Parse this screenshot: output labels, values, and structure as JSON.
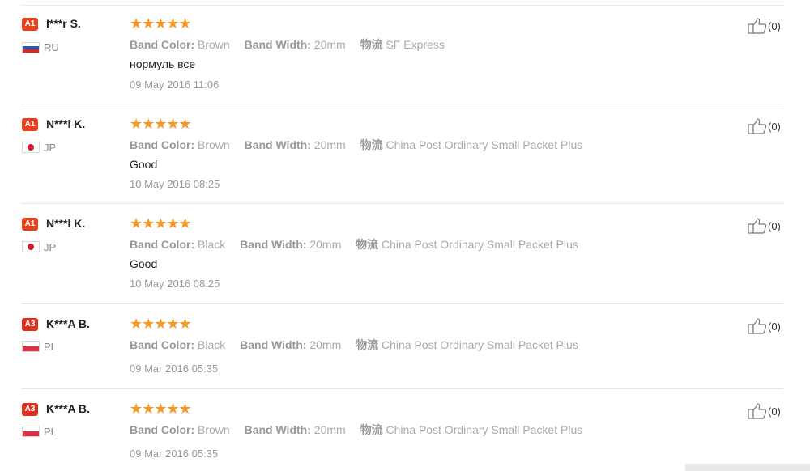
{
  "reviews": [
    {
      "badge": "A1",
      "badge_color": "#e8421c",
      "name": "I***r S.",
      "country": "RU",
      "flag": "ru",
      "stars": "★★★★★",
      "attrs": [
        {
          "key": "Band Color:",
          "value": "Brown"
        },
        {
          "key": "Band Width:",
          "value": "20mm"
        },
        {
          "key": "物流",
          "value": "SF Express"
        }
      ],
      "comment": "нормуль все",
      "date": "09 May 2016 11:06",
      "likes": "(0)"
    },
    {
      "badge": "A1",
      "badge_color": "#e8421c",
      "name": "N***l K.",
      "country": "JP",
      "flag": "jp",
      "stars": "★★★★★",
      "attrs": [
        {
          "key": "Band Color:",
          "value": "Brown"
        },
        {
          "key": "Band Width:",
          "value": "20mm"
        },
        {
          "key": "物流",
          "value": "China Post Ordinary Small Packet Plus"
        }
      ],
      "comment": "Good",
      "date": "10 May 2016 08:25",
      "likes": "(0)"
    },
    {
      "badge": "A1",
      "badge_color": "#e8421c",
      "name": "N***l K.",
      "country": "JP",
      "flag": "jp",
      "stars": "★★★★★",
      "attrs": [
        {
          "key": "Band Color:",
          "value": "Black"
        },
        {
          "key": "Band Width:",
          "value": "20mm"
        },
        {
          "key": "物流",
          "value": "China Post Ordinary Small Packet Plus"
        }
      ],
      "comment": "Good",
      "date": "10 May 2016 08:25",
      "likes": "(0)"
    },
    {
      "badge": "A3",
      "badge_color": "#d9331f",
      "name": "K***A B.",
      "country": "PL",
      "flag": "pl",
      "stars": "★★★★★",
      "attrs": [
        {
          "key": "Band Color:",
          "value": "Black"
        },
        {
          "key": "Band Width:",
          "value": "20mm"
        },
        {
          "key": "物流",
          "value": "China Post Ordinary Small Packet Plus"
        }
      ],
      "comment": "",
      "date": "09 Mar 2016 05:35",
      "likes": "(0)"
    },
    {
      "badge": "A3",
      "badge_color": "#d9331f",
      "name": "K***A B.",
      "country": "PL",
      "flag": "pl",
      "stars": "★★★★★",
      "attrs": [
        {
          "key": "Band Color:",
          "value": "Brown"
        },
        {
          "key": "Band Width:",
          "value": "20mm"
        },
        {
          "key": "物流",
          "value": "China Post Ordinary Small Packet Plus"
        }
      ],
      "comment": "",
      "date": "09 Mar 2016 05:35",
      "likes": "(0)"
    }
  ],
  "colors": {
    "star": "#f79824",
    "divider": "#e6e6e6"
  }
}
